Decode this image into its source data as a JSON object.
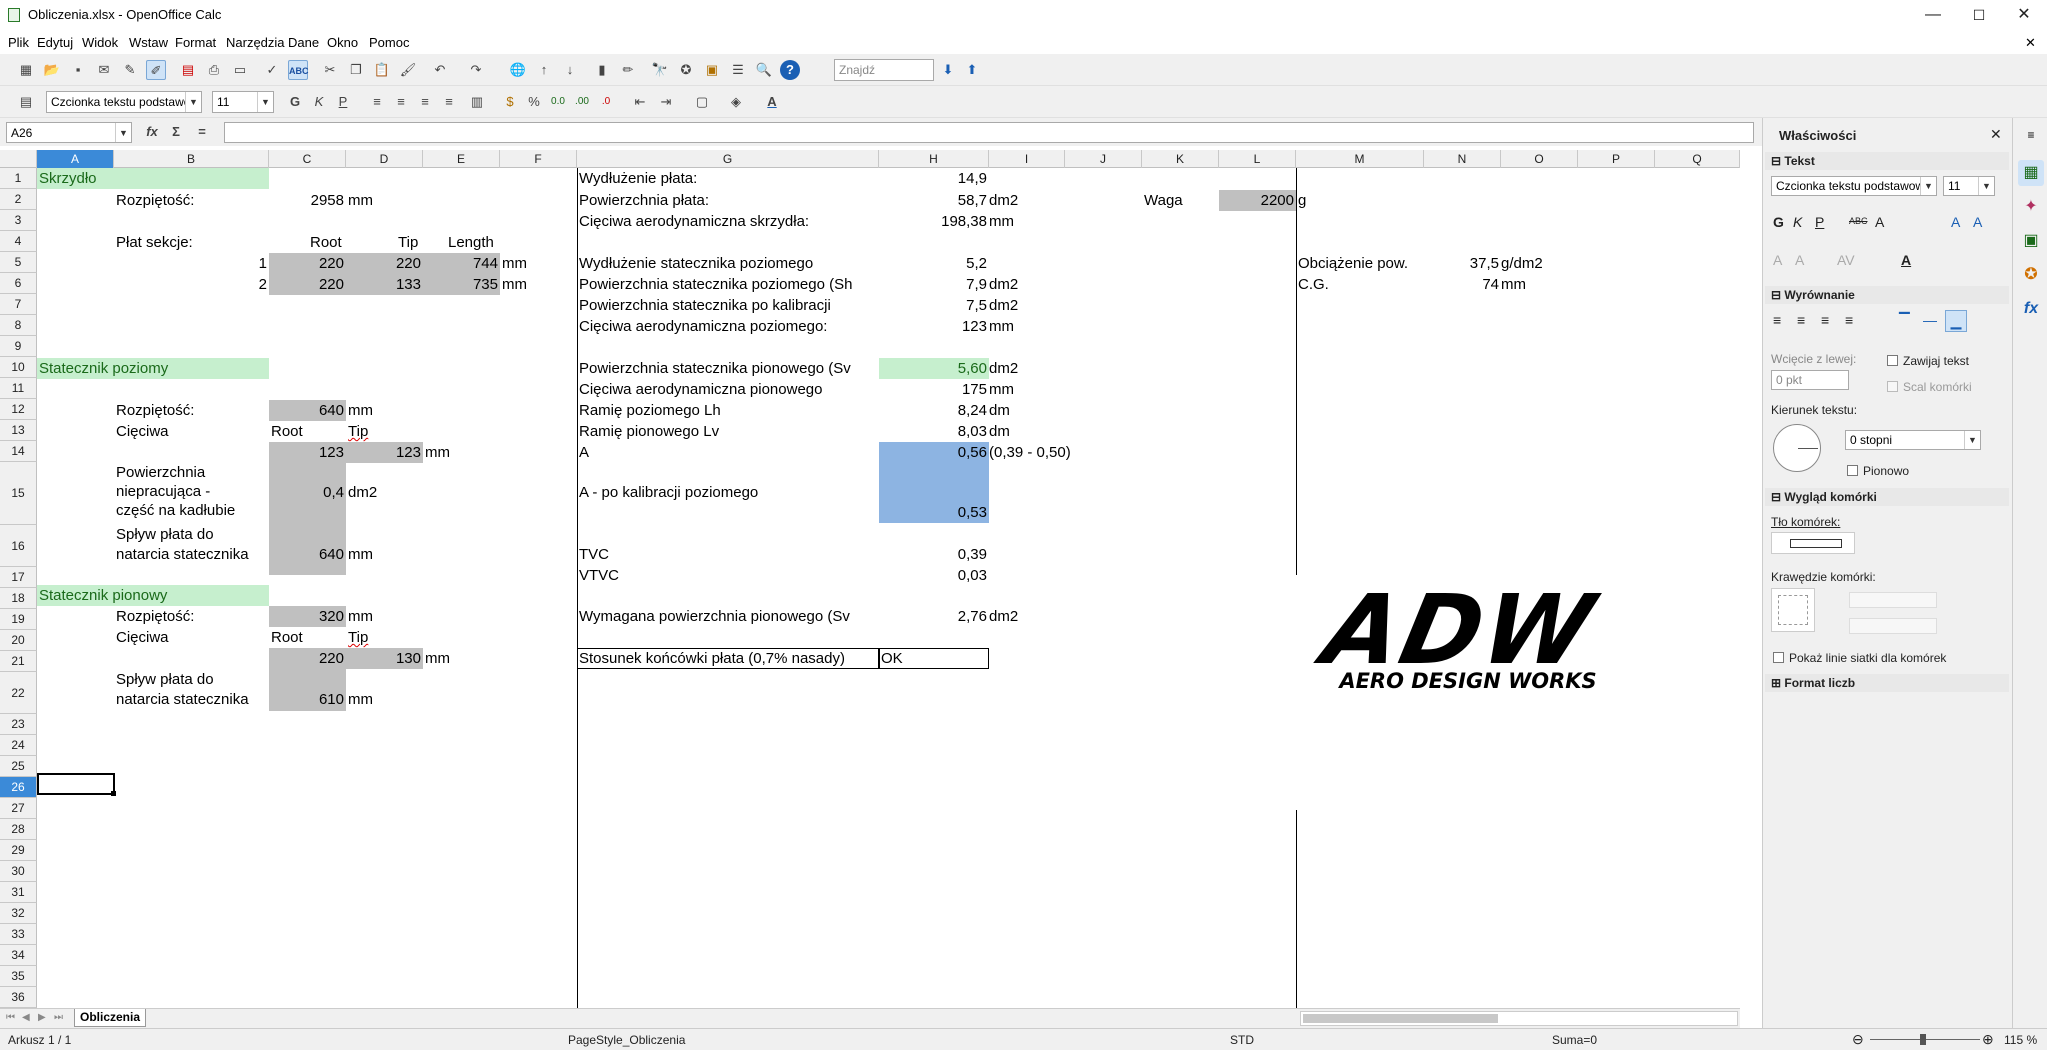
{
  "window": {
    "title": "Obliczenia.xlsx - OpenOffice Calc",
    "minimize": "—",
    "maximize": "☐",
    "close": "✕",
    "doc_close": "✕"
  },
  "menu": [
    "Plik",
    "Edytuj",
    "Widok",
    "Wstaw",
    "Format",
    "Narzędzia",
    "Dane",
    "Okno",
    "Pomoc"
  ],
  "toolbar": {
    "find_placeholder": "Znajdź",
    "font_name": "Czcionka tekstu podstawow",
    "font_size": "11"
  },
  "formula": {
    "name_box": "A26",
    "content": ""
  },
  "columns": [
    "A",
    "B",
    "C",
    "D",
    "E",
    "F",
    "G",
    "H",
    "I",
    "J",
    "K",
    "L",
    "M",
    "N",
    "O",
    "P",
    "Q"
  ],
  "rows": [
    "1",
    "2",
    "3",
    "4",
    "5",
    "6",
    "7",
    "8",
    "9",
    "10",
    "11",
    "12",
    "13",
    "14",
    "15",
    "16",
    "17",
    "18",
    "19",
    "20",
    "21",
    "22",
    "23",
    "24",
    "25",
    "26",
    "27",
    "28",
    "29",
    "30",
    "31",
    "32",
    "33",
    "34",
    "35",
    "36"
  ],
  "cells": {
    "skrzydlo": "Skrzydło",
    "rozpietosc": "Rozpiętość:",
    "rozp_val": "2958",
    "mm": "mm",
    "plat_sekcje": "Płat sekcje:",
    "root": "Root",
    "tip": "Tip",
    "length": "Length",
    "s1": "1",
    "s1_root": "220",
    "s1_tip": "220",
    "s1_len": "744",
    "s2": "2",
    "s2_root": "220",
    "s2_tip": "133",
    "s2_len": "735",
    "stat_poz": "Statecznik poziomy",
    "sp_rozp_val": "640",
    "cieciwa": "Cięciwa",
    "cieciwa_colon": "Cięciwa:",
    "sp_root": "123",
    "sp_tip": "123",
    "pow_niepr_1": "Powierzchnia",
    "pow_niepr_2": "niepracująca -",
    "pow_niepr_3": "część na kadłubie",
    "pow_niepr_val": "0,4",
    "dm2": "dm2",
    "splyw_1": "Spływ płata do",
    "splyw_2": "natarcia statecznika",
    "splyw_val": "640",
    "stat_pion": "Statecznik pionowy",
    "pion_rozp_val": "320",
    "pion_root": "220",
    "pion_tip": "130",
    "pion_splyw_val": "610",
    "g1": "Wydłużenie płata:",
    "h1": "14,9",
    "g2": "Powierzchnia płata:",
    "h2": "58,7",
    "i2": "dm2",
    "k2": "Waga",
    "l2": "2200",
    "g_unit": "g",
    "g3": "Cięciwa aerodynamiczna skrzydła:",
    "h3": "198,38",
    "i3": "mm",
    "g5": "Wydłużenie statecznika poziomego",
    "h5": "5,2",
    "m5": "Obciążenie pow.",
    "n5": "37,5",
    "o5": "g/dm2",
    "g6": "Powierzchnia statecznika poziomego (Sh",
    "h6": "7,9",
    "i6": "dm2",
    "m6": "C.G.",
    "n6": "74",
    "o6": "mm",
    "g7": "Powierzchnia statecznika po kalibracji",
    "h7": "7,5",
    "i7": "dm2",
    "g8": "Cięciwa aerodynamiczna poziomego:",
    "h8": "123",
    "i8": "mm",
    "g10": "Powierzchnia statecznika pionowego (Sv",
    "h10": "5,60",
    "i10": "dm2",
    "g11": "Cięciwa aerodynamiczna pionowego",
    "h11": "175",
    "i11": "mm",
    "g12": "Ramię poziomego Lh",
    "h12": "8,24",
    "i12": "dm",
    "g13": "Ramię pionowego Lv",
    "h13": "8,03",
    "i13": "dm",
    "g14": "A",
    "h14": "0,56",
    "i14": "(0,39 - 0,50)",
    "g15": "A - po kalibracji poziomego",
    "h15": "0,53",
    "g16": "TVC",
    "h16": "0,39",
    "g17": "VTVC",
    "h17": "0,03",
    "g19": "Wymagana powierzchnia pionowego (Sv",
    "h19": "2,76",
    "i19": "dm2",
    "g21": "Stosunek końcówki płata (0,7% nasady)",
    "h21": "OK"
  },
  "logo": {
    "big": "ADW",
    "small": "AERO DESIGN WORKS"
  },
  "sidebar": {
    "title": "Właściwości",
    "tekst": "Tekst",
    "font_name": "Czcionka tekstu podstawow",
    "font_size": "11",
    "wyrownanie": "Wyrównanie",
    "wciecie": "Wcięcie z lewej:",
    "wciecie_val": "0 pkt",
    "zawijaj": "Zawijaj tekst",
    "scal": "Scal komórki",
    "kierunek": "Kierunek tekstu:",
    "kierunek_val": "0 stopni",
    "pionowo": "Pionowo",
    "wyglad": "Wygląd komórki",
    "tlo": "Tło komórek:",
    "krawedzie": "Krawędzie komórki:",
    "pokaz": "Pokaż linie siatki dla komórek",
    "format_liczb": "Format liczb"
  },
  "sheet_tab": "Obliczenia",
  "status": {
    "sheet": "Arkusz 1 / 1",
    "pagestyle": "PageStyle_Obliczenia",
    "mode": "STD",
    "sum": "Suma=0",
    "zoom": "115 %"
  }
}
